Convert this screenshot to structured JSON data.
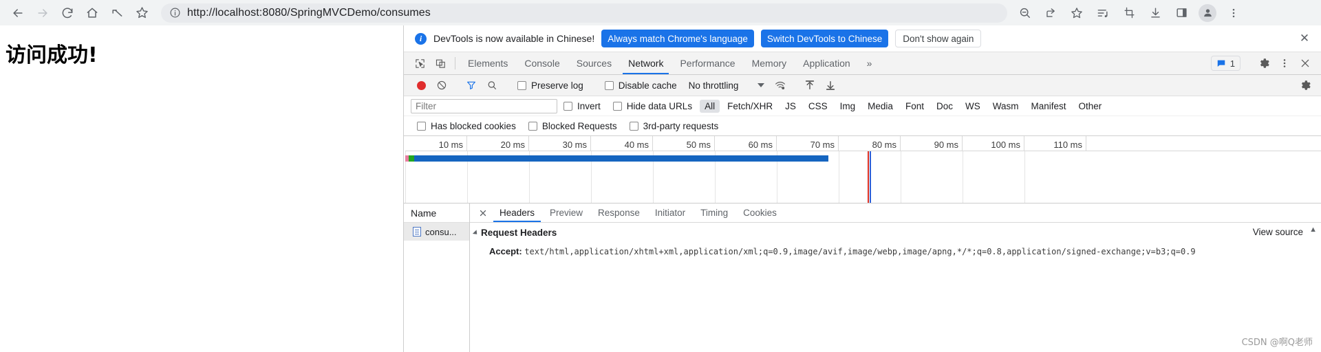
{
  "browser": {
    "nav": [
      {
        "name": "back-button",
        "glyph": "←",
        "state": "enabled"
      },
      {
        "name": "forward-button",
        "glyph": "→",
        "state": "disabled"
      },
      {
        "name": "reload-button",
        "glyph": "⟳",
        "state": "enabled"
      },
      {
        "name": "home-button",
        "glyph": "⌂",
        "state": "enabled"
      },
      {
        "name": "undo-button",
        "glyph": "↰",
        "state": "enabled"
      },
      {
        "name": "bookmark-star-button",
        "glyph": "☆",
        "state": "enabled"
      }
    ],
    "omnibox": {
      "scheme": "http://",
      "rest": "localhost:8080/SpringMVCDemo/consumes",
      "full_url": "http://localhost:8080/SpringMVCDemo/consumes",
      "site_info_icon": "info-circle-icon"
    },
    "right_icons": [
      {
        "name": "zoom-out-icon",
        "glyph": "⊖"
      },
      {
        "name": "share-icon",
        "glyph": "↗"
      },
      {
        "name": "bookmark-star-icon",
        "glyph": "☆"
      },
      {
        "name": "media-playlist-icon",
        "glyph": "♪"
      },
      {
        "name": "screen-capture-icon",
        "glyph": "⌗"
      },
      {
        "name": "download-icon",
        "glyph": "↓"
      },
      {
        "name": "side-panel-icon",
        "glyph": "▭"
      },
      {
        "name": "profile-avatar",
        "glyph": "●"
      },
      {
        "name": "chrome-menu-icon",
        "glyph": "⋮"
      }
    ]
  },
  "page": {
    "heading": "访问成功!"
  },
  "devtools": {
    "notification": {
      "icon": "info-icon",
      "message": "DevTools is now available in Chinese!",
      "primary_button": "Always match Chrome's language",
      "secondary_button": "Switch DevTools to Chinese",
      "dismiss_button": "Don't show again",
      "close_icon": "✕"
    },
    "tabs": [
      {
        "label": "Elements",
        "active": false
      },
      {
        "label": "Console",
        "active": false
      },
      {
        "label": "Sources",
        "active": false
      },
      {
        "label": "Network",
        "active": true
      },
      {
        "label": "Performance",
        "active": false
      },
      {
        "label": "Memory",
        "active": false
      },
      {
        "label": "Application",
        "active": false
      }
    ],
    "tabbar_icons": {
      "inspect": "inspect-element-icon",
      "device": "device-toolbar-icon",
      "overflow": "»",
      "message_count": "1",
      "settings": "gear-icon",
      "more": "⋮",
      "close": "✕"
    },
    "network_toolbar": {
      "record_tooltip": "record-button",
      "clear_tooltip": "clear-button",
      "filter_tooltip": "filter-button",
      "search_tooltip": "search-button",
      "preserve_log": "Preserve log",
      "disable_cache": "Disable cache",
      "throttling": "No throttling",
      "network_conditions_icon": "wifi-settings-icon",
      "import_icon": "import-har-icon",
      "export_icon": "export-har-icon",
      "settings_icon": "gear-icon"
    },
    "filter_bar": {
      "placeholder": "Filter",
      "invert": "Invert",
      "hide_data_urls": "Hide data URLs",
      "types": [
        "All",
        "Fetch/XHR",
        "JS",
        "CSS",
        "Img",
        "Media",
        "Font",
        "Doc",
        "WS",
        "Wasm",
        "Manifest",
        "Other"
      ],
      "active_type": "All",
      "has_blocked_cookies": "Has blocked cookies",
      "blocked_requests": "Blocked Requests",
      "third_party_requests": "3rd-party requests"
    },
    "timeline": {
      "ticks": [
        "10 ms",
        "20 ms",
        "30 ms",
        "40 ms",
        "50 ms",
        "60 ms",
        "70 ms",
        "80 ms",
        "90 ms",
        "100 ms",
        "110 ms"
      ],
      "bar_start_ms": 0,
      "bar_end_ms": 63,
      "event_line_red_ms": 70.5,
      "event_line_blue_ms": 70.8
    },
    "request_list": {
      "column_header": "Name",
      "rows": [
        {
          "name": "consu...",
          "icon": "document-icon",
          "selected": true
        }
      ]
    },
    "detail_tabs": [
      {
        "label": "Headers",
        "active": true
      },
      {
        "label": "Preview",
        "active": false
      },
      {
        "label": "Response",
        "active": false
      },
      {
        "label": "Initiator",
        "active": false
      },
      {
        "label": "Timing",
        "active": false
      },
      {
        "label": "Cookies",
        "active": false
      }
    ],
    "headers_panel": {
      "section_title": "Request Headers",
      "view_source": "View source",
      "entries": [
        {
          "name": "Accept:",
          "value": "text/html,application/xhtml+xml,application/xml;q=0.9,image/avif,image/webp,image/apng,*/*;q=0.8,application/signed-exchange;v=b3;q=0.9"
        }
      ]
    }
  },
  "watermark": "CSDN @啊Q老师"
}
